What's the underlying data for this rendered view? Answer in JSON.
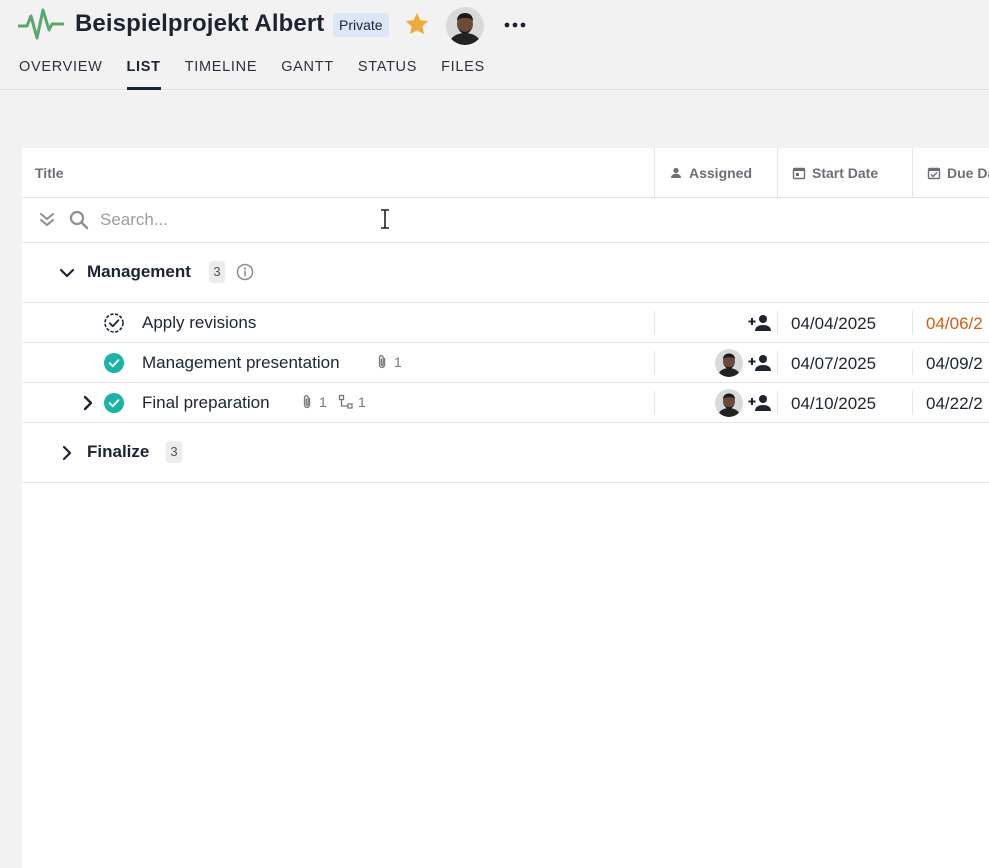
{
  "project": {
    "title": "Beispielprojekt Albert",
    "visibility_badge": "Private",
    "favorite_icon": "star-icon",
    "logo_icon": "pulse-logo-icon",
    "more_icon": "more-horizontal-icon"
  },
  "tabs": [
    {
      "label": "OVERVIEW",
      "active": false
    },
    {
      "label": "LIST",
      "active": true
    },
    {
      "label": "TIMELINE",
      "active": false
    },
    {
      "label": "GANTT",
      "active": false
    },
    {
      "label": "STATUS",
      "active": false
    },
    {
      "label": "FILES",
      "active": false
    }
  ],
  "columns": {
    "title": "Title",
    "assigned": "Assigned",
    "start_date": "Start Date",
    "due_date": "Due Da"
  },
  "search": {
    "placeholder": "Search...",
    "value": ""
  },
  "groups": [
    {
      "name": "Management",
      "count": "3",
      "expanded": true,
      "tasks": [
        {
          "title": "Apply revisions",
          "status": "open",
          "attachments": "",
          "subtasks": "",
          "has_assignee": false,
          "start": "04/04/2025",
          "due": "04/06/2",
          "overdue": true
        },
        {
          "title": "Management presentation",
          "status": "done",
          "attachments": "1",
          "subtasks": "",
          "has_assignee": true,
          "start": "04/07/2025",
          "due": "04/09/2",
          "overdue": false
        },
        {
          "title": "Final preparation",
          "status": "done",
          "attachments": "1",
          "subtasks": "1",
          "has_assignee": true,
          "start": "04/10/2025",
          "due": "04/22/2",
          "overdue": false
        }
      ]
    },
    {
      "name": "Finalize",
      "count": "3",
      "expanded": false,
      "tasks": []
    }
  ],
  "colors": {
    "accent_green": "#5aa66b",
    "done_teal": "#1bb3a5",
    "star": "#f2a93b",
    "overdue": "#d35c12",
    "nav_text": "#1d2433"
  }
}
